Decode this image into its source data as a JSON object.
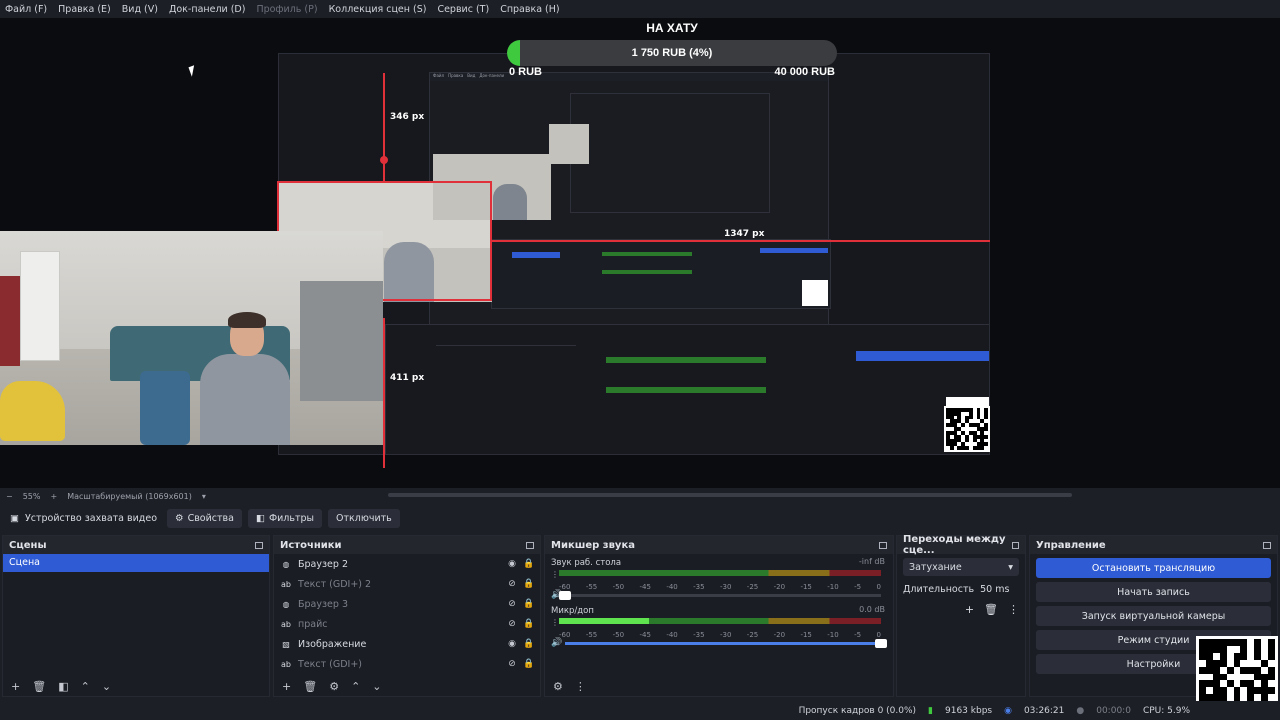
{
  "menu": [
    "Файл (F)",
    "Правка (E)",
    "Вид (V)",
    "Док-панели (D)",
    "Профиль (P)",
    "Коллекция сцен (S)",
    "Сервис (T)",
    "Справка (H)"
  ],
  "donation": {
    "title": "НА ХАТУ",
    "bar_text": "1 750 RUB (4%)",
    "progress_percent": 4,
    "min": "0 RUB",
    "max": "40 000 RUB",
    "accent": "#3ec93e"
  },
  "measure": {
    "top": "346 px",
    "right": "1347 px",
    "left": "411 px"
  },
  "preview_status": {
    "zoom": "55%",
    "scale_mode": "Масштабируемый (1069x601)"
  },
  "source_toolbar": {
    "device": "Устройство захвата видео",
    "properties": "Свойства",
    "filters": "Фильтры",
    "disconnect": "Отключить"
  },
  "scenes": {
    "title": "Сцены",
    "items": [
      "Сцена"
    ]
  },
  "sources": {
    "title": "Источники",
    "items": [
      {
        "name": "Браузер 2",
        "icon": "globe-icon",
        "visible": true
      },
      {
        "name": "Текст (GDI+) 2",
        "icon": "text-icon",
        "visible": false
      },
      {
        "name": "Браузер 3",
        "icon": "globe-icon",
        "visible": false
      },
      {
        "name": "прайс",
        "icon": "text-icon",
        "visible": false
      },
      {
        "name": "Изображение",
        "icon": "image-icon",
        "visible": true
      },
      {
        "name": "Текст (GDI+)",
        "icon": "text-icon",
        "visible": false
      }
    ]
  },
  "mixer": {
    "title": "Микшер звука",
    "tracks": [
      {
        "name": "Звук раб. стола",
        "db": "-inf dB",
        "level_percent": 0,
        "fader_percent": 0
      },
      {
        "name": "Микр/доп",
        "db": "0.0 dB",
        "level_percent": 28,
        "fader_percent": 100
      }
    ],
    "scale": [
      "-60",
      "-55",
      "-50",
      "-45",
      "-40",
      "-35",
      "-30",
      "-25",
      "-20",
      "-15",
      "-10",
      "-5",
      "0"
    ]
  },
  "transitions": {
    "title": "Переходы между сце...",
    "selected": "Затухание",
    "duration_label": "Длительность",
    "duration_value": "50 ms"
  },
  "controls": {
    "title": "Управление",
    "stop_stream": "Остановить трансляцию",
    "start_record": "Начать запись",
    "virtual_cam": "Запуск виртуальной камеры",
    "studio_mode": "Режим студии",
    "settings": "Настройки"
  },
  "statusbar": {
    "dropped": "Пропуск кадров 0 (0.0%)",
    "bitrate": "9163 kbps",
    "live_time": "03:26:21",
    "rec_time": "00:00:0",
    "cpu": "CPU: 5.9%"
  },
  "colors": {
    "primary": "#2f5bd4",
    "bg": "#1d1f26",
    "red": "#e0303a"
  }
}
